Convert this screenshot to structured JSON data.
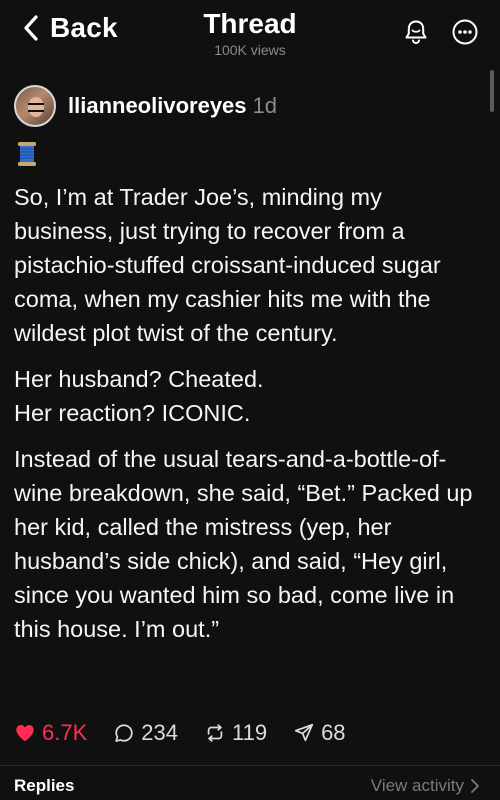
{
  "header": {
    "back_label": "Back",
    "title": "Thread",
    "views": "100K views",
    "icons": {
      "bell": "bell-icon",
      "more": "more-icon"
    }
  },
  "post": {
    "username": "llianneolivoreyes",
    "time": "1d",
    "emoji": "spool-of-thread",
    "paragraphs": [
      "So, I’m at Trader Joe’s, minding my business, just trying to recover from a pistachio-stuffed croissant-induced sugar coma, when my cashier hits me with the wildest plot twist of the century.",
      "Her husband? Cheated.",
      "Her reaction? ICONIC.",
      "Instead of the usual tears-and-a-bottle-of-wine breakdown, she said, “Bet.” Packed up her kid, called the mistress (yep, her husband’s side chick), and said, “Hey girl, since you wanted him so bad, come live in this house. I’m out.”"
    ],
    "stats": {
      "likes": "6.7K",
      "comments": "234",
      "reposts": "119",
      "shares": "68"
    }
  },
  "footer": {
    "replies_label": "Replies",
    "view_activity_label": "View activity"
  },
  "colors": {
    "background": "#101010",
    "like": "#ff2d55",
    "muted": "#8a8a8a"
  }
}
